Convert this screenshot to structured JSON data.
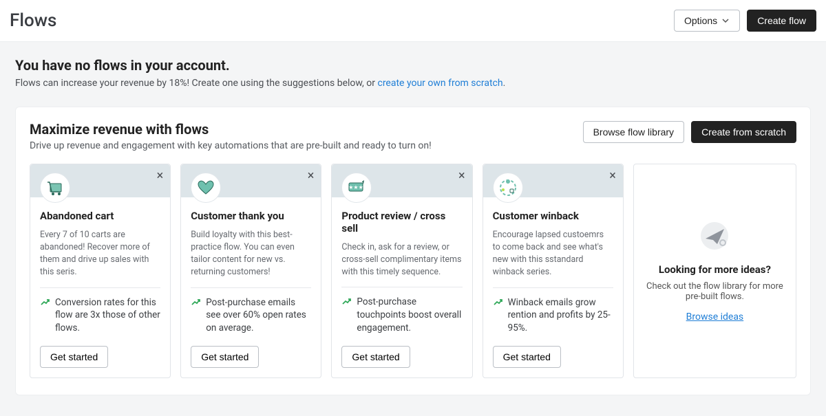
{
  "topbar": {
    "title": "Flows",
    "options_label": "Options",
    "create_label": "Create flow"
  },
  "intro": {
    "heading": "You have no flows in your account.",
    "text_prefix": "Flows can increase your revenue by 18%! Create one using the suggestions below, or ",
    "link_text": "create your own from scratch",
    "text_suffix": "."
  },
  "panel": {
    "heading": "Maximize revenue with flows",
    "subheading": "Drive up revenue and engagement with key automations that are pre-built and ready to turn on!",
    "browse_label": "Browse flow library",
    "scratch_label": "Create from scratch"
  },
  "cards": [
    {
      "title": "Abandoned cart",
      "desc": "Every 7 of 10 carts are abandoned! Recover more of them and drive up sales with this seris.",
      "stat": "Conversion rates for this flow are 3x those of other flows.",
      "cta": "Get started"
    },
    {
      "title": "Customer thank you",
      "desc": "Build loyalty with this best-practice flow. You can even tailor content for new vs. returning customers!",
      "stat": "Post-purchase emails see over 60% open rates on average.",
      "cta": "Get started"
    },
    {
      "title": "Product review / cross sell",
      "desc": "Check in, ask for a review, or cross-sell complimentary items with this timely sequence.",
      "stat": "Post-purchase touchpoints boost overall engagement.",
      "cta": "Get started"
    },
    {
      "title": "Customer winback",
      "desc": "Encourage lapsed custoemrs to come back and see what's new with this sstandard winback series.",
      "stat": "Winback emails grow rention and profits by 25-95%.",
      "cta": "Get started"
    }
  ],
  "more": {
    "heading": "Looking for more ideas?",
    "text": "Check out the flow library for more pre-built flows.",
    "link": "Browse ideas"
  }
}
